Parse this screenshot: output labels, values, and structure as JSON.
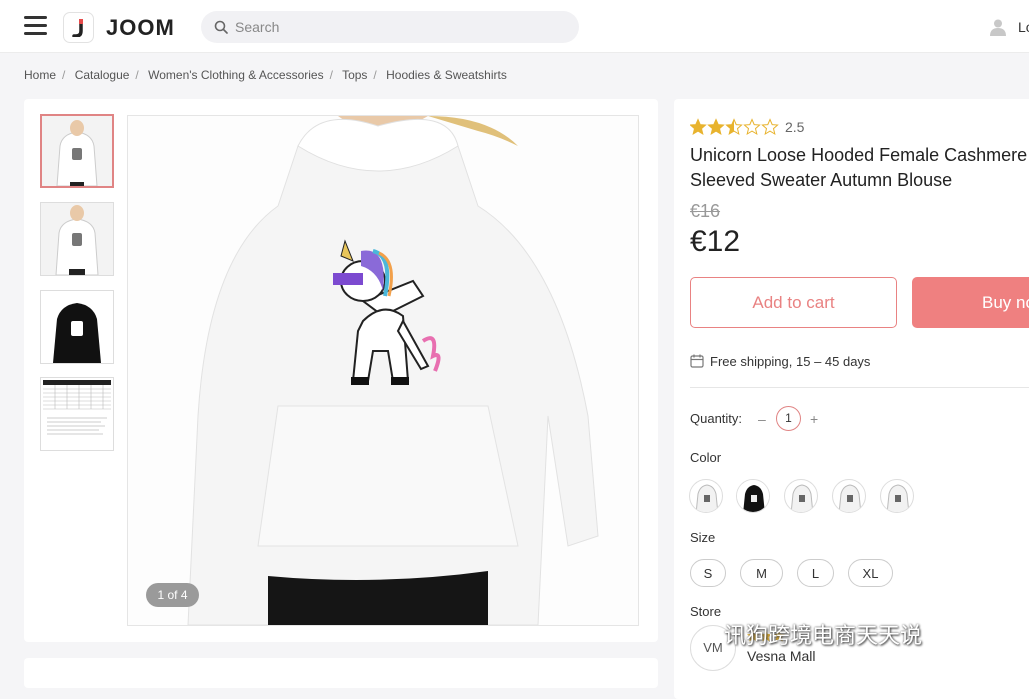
{
  "header": {
    "logo_text": "JOOM",
    "search_placeholder": "Search",
    "login_label": "Lo"
  },
  "breadcrumb": [
    "Home",
    "Catalogue",
    "Women's Clothing & Accessories",
    "Tops",
    "Hoodies & Sweatshirts"
  ],
  "gallery": {
    "counter": "1 of 4",
    "accent_color": "#e08484"
  },
  "product": {
    "rating": "2.5",
    "rating_value": 2.5,
    "title_line1": "Unicorn Loose Hooded Female Cashmere T",
    "title_line2": "Sleeved Sweater Autumn Blouse",
    "old_price": "€16",
    "price": "€12",
    "add_to_cart": "Add to cart",
    "buy_now": "Buy no",
    "shipping": "Free shipping, 15 – 45 days",
    "quantity_label": "Quantity:",
    "quantity_value": "1",
    "qty_minus": "–",
    "qty_plus": "+",
    "color_label": "Color",
    "size_label": "Size",
    "sizes": [
      "S",
      "M",
      "L",
      "XL"
    ],
    "store_label": "Store",
    "store_initials": "VM",
    "store_name": "Vesna Mall"
  },
  "watermark": "讯狗跨境电商天天说",
  "colors": {
    "brand": "#ef8080",
    "star": "#e8b32e"
  }
}
